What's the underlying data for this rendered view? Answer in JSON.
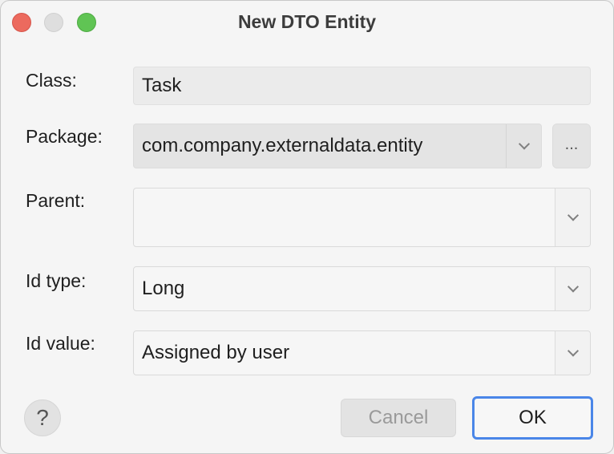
{
  "window": {
    "title": "New DTO Entity"
  },
  "form": {
    "class_label": "Class:",
    "class_value": "Task",
    "package_label": "Package:",
    "package_value": "com.company.externaldata.entity",
    "browse_label": "...",
    "parent_label": "Parent:",
    "parent_value": "",
    "id_type_label": "Id type:",
    "id_type_value": "Long",
    "id_value_label": "Id value:",
    "id_value_value": "Assigned by user"
  },
  "footer": {
    "help_label": "?",
    "cancel_label": "Cancel",
    "ok_label": "OK"
  },
  "colors": {
    "close": "#ec6a5e",
    "maximize": "#60c454",
    "focus_ring": "#4a86e8"
  }
}
